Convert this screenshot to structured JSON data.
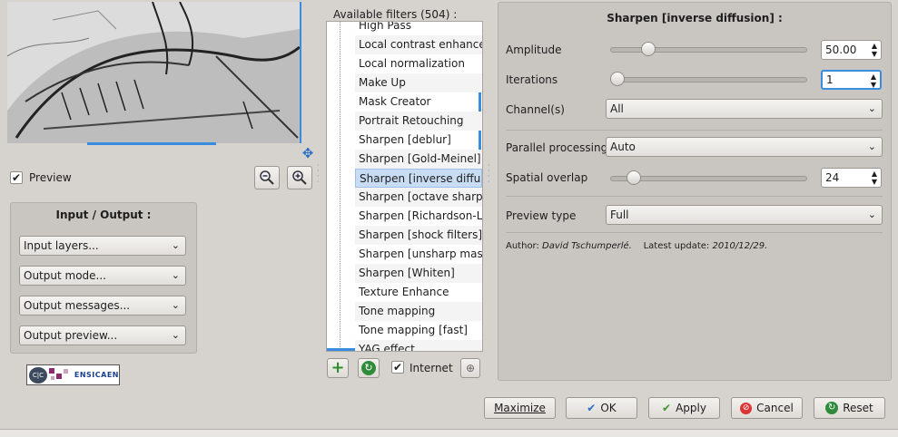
{
  "preview": {
    "checkbox_label": "Preview"
  },
  "io": {
    "title": "Input / Output :",
    "combos": [
      {
        "label": "Input layers..."
      },
      {
        "label": "Output mode..."
      },
      {
        "label": "Output messages..."
      },
      {
        "label": "Output preview..."
      }
    ]
  },
  "logos": {
    "left_text": "C|C",
    "right_text": "ENSICAEN"
  },
  "filters": {
    "header": "Available filters (504) :",
    "items": [
      {
        "label": "High Pass"
      },
      {
        "label": "Local contrast enhancem"
      },
      {
        "label": "Local normalization"
      },
      {
        "label": "Make Up"
      },
      {
        "label": "Mask Creator"
      },
      {
        "label": "Portrait Retouching"
      },
      {
        "label": "Sharpen [deblur]"
      },
      {
        "label": "Sharpen [Gold-Meinel]"
      },
      {
        "label": "Sharpen [inverse diffusio"
      },
      {
        "label": "Sharpen [octave sharpen"
      },
      {
        "label": "Sharpen [Richardson-Lucy"
      },
      {
        "label": "Sharpen [shock filters]"
      },
      {
        "label": "Sharpen [unsharp mask]"
      },
      {
        "label": "Sharpen [Whiten]"
      },
      {
        "label": "Texture Enhance"
      },
      {
        "label": "Tone mapping"
      },
      {
        "label": "Tone mapping [fast]"
      },
      {
        "label": "YAG effect"
      }
    ],
    "selected_index": 8,
    "internet_label": "Internet"
  },
  "params": {
    "title": "Sharpen [inverse diffusion] :",
    "amplitude": {
      "label": "Amplitude",
      "value": "50.00",
      "fraction": 0.17
    },
    "iterations": {
      "label": "Iterations",
      "value": "1",
      "fraction": 0.0
    },
    "channels": {
      "label": "Channel(s)",
      "value": "All"
    },
    "parallel": {
      "label": "Parallel processing",
      "value": "Auto"
    },
    "overlap": {
      "label": "Spatial overlap",
      "value": "24",
      "fraction": 0.09
    },
    "preview_type": {
      "label": "Preview type",
      "value": "Full"
    },
    "author_prefix": "Author: ",
    "author_name": "David Tschumperlé.",
    "update_prefix": "Latest update: ",
    "update_date": "2010/12/29."
  },
  "buttons": {
    "maximize": "Maximize",
    "ok": "OK",
    "apply": "Apply",
    "cancel": "Cancel",
    "reset": "Reset"
  },
  "colors": {
    "selection": "#c8dcf3",
    "accent": "#3a8dde",
    "ok_check": "#2a6fc9",
    "apply_check": "#3c9a2a",
    "cancel_icon": "#d33",
    "reset_icon": "#2e8b3a"
  }
}
